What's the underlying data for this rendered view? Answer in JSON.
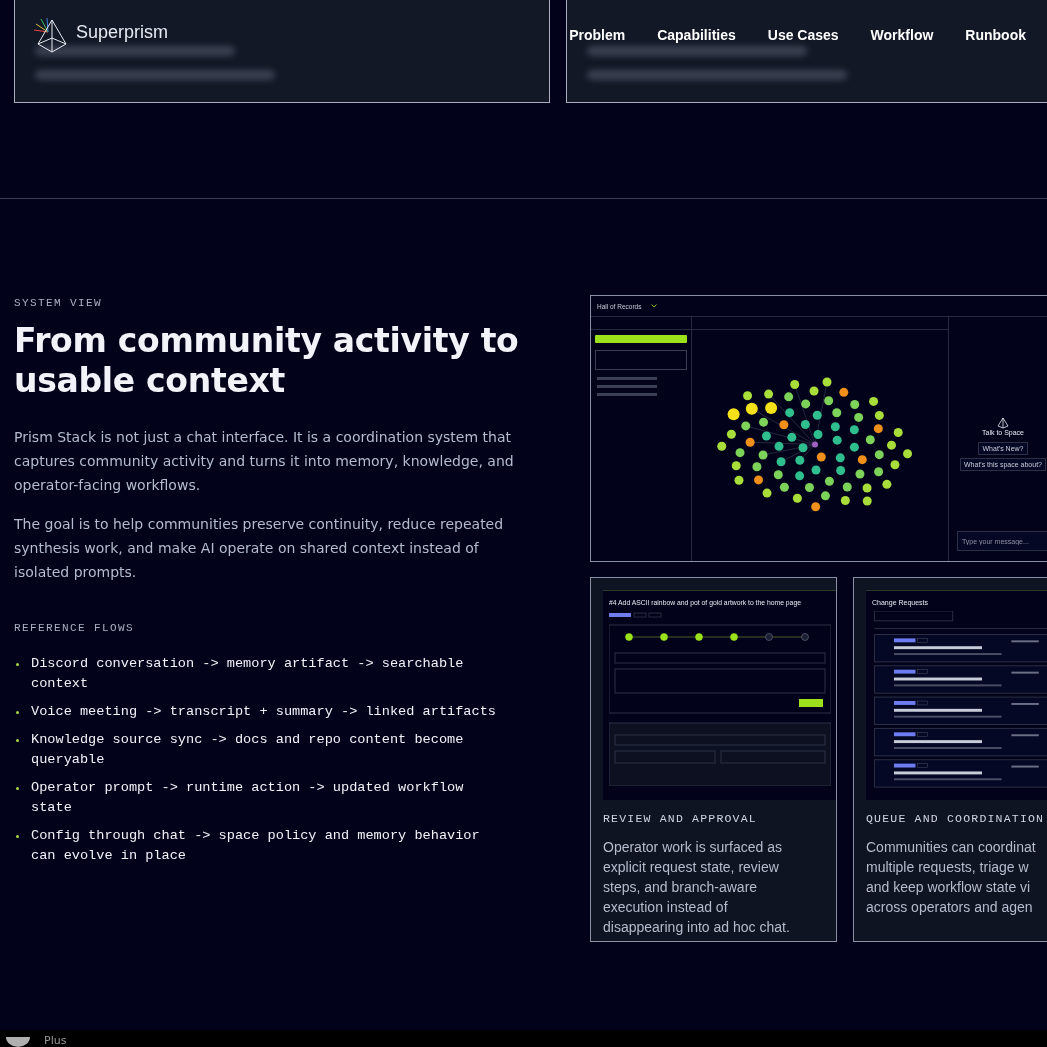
{
  "nav": {
    "brand": "Superprism",
    "links": [
      "Problem",
      "Capabilities",
      "Use Cases",
      "Workflow",
      "Runbook"
    ]
  },
  "section": {
    "eyebrow": "SYSTEM VIEW",
    "title": "From community activity to usable context",
    "paragraphs": [
      "Prism Stack is not just a chat interface. It is a coordination system that captures community activity and turns it into memory, knowledge, and operator-facing workflows.",
      "The goal is to help communities preserve continuity, reduce repeated synthesis work, and make AI operate on shared context instead of isolated prompts."
    ],
    "flows_label": "REFERENCE FLOWS",
    "flows": [
      "Discord conversation -> memory artifact -> searchable context",
      "Voice meeting -> transcript + summary -> linked artifacts",
      "Knowledge source sync -> docs and repo content become queryable",
      "Operator prompt -> runtime action -> updated workflow state",
      "Config through chat -> space policy and memory behavior can evolve in place"
    ]
  },
  "system_shot": {
    "workspace": "Hall of Records",
    "chat_title": "Talk to Space",
    "suggestions": [
      "What's New?",
      "What's this space about?"
    ],
    "placeholder": "Type your message..."
  },
  "cards": [
    {
      "kind": "review",
      "screen_title": "#4 Add ASCII rainbow and pot of gold artwork to the home page",
      "caption": "REVIEW AND APPROVAL",
      "lines": [
        "Operator work is surfaced as",
        "explicit request state, review",
        "steps, and branch-aware",
        "execution instead of",
        "disappearing into ad hoc chat."
      ]
    },
    {
      "kind": "queue",
      "screen_title": "Change Requests",
      "caption": "QUEUE AND COORDINATION",
      "lines": [
        "Communities can coordinat",
        "multiple requests, triage w",
        "and keep workflow state vi",
        "across operators and agen"
      ]
    }
  ],
  "taskbar": {
    "label": "Plus"
  }
}
